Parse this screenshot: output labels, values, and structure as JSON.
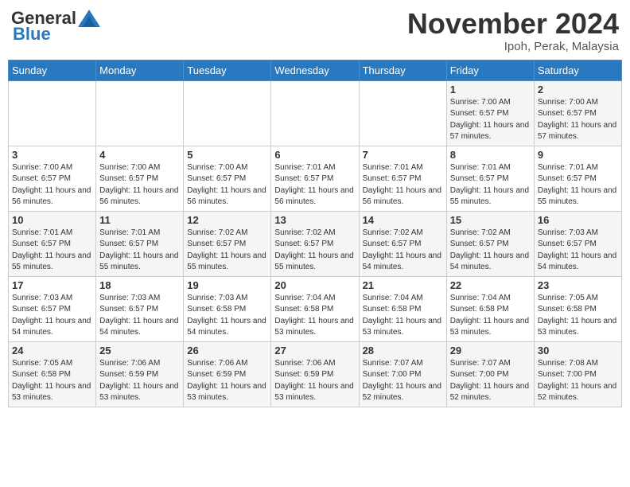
{
  "header": {
    "logo_general": "General",
    "logo_blue": "Blue",
    "month_title": "November 2024",
    "location": "Ipoh, Perak, Malaysia"
  },
  "days_of_week": [
    "Sunday",
    "Monday",
    "Tuesday",
    "Wednesday",
    "Thursday",
    "Friday",
    "Saturday"
  ],
  "weeks": [
    [
      {
        "day": "",
        "info": ""
      },
      {
        "day": "",
        "info": ""
      },
      {
        "day": "",
        "info": ""
      },
      {
        "day": "",
        "info": ""
      },
      {
        "day": "",
        "info": ""
      },
      {
        "day": "1",
        "info": "Sunrise: 7:00 AM\nSunset: 6:57 PM\nDaylight: 11 hours and 57 minutes."
      },
      {
        "day": "2",
        "info": "Sunrise: 7:00 AM\nSunset: 6:57 PM\nDaylight: 11 hours and 57 minutes."
      }
    ],
    [
      {
        "day": "3",
        "info": "Sunrise: 7:00 AM\nSunset: 6:57 PM\nDaylight: 11 hours and 56 minutes."
      },
      {
        "day": "4",
        "info": "Sunrise: 7:00 AM\nSunset: 6:57 PM\nDaylight: 11 hours and 56 minutes."
      },
      {
        "day": "5",
        "info": "Sunrise: 7:00 AM\nSunset: 6:57 PM\nDaylight: 11 hours and 56 minutes."
      },
      {
        "day": "6",
        "info": "Sunrise: 7:01 AM\nSunset: 6:57 PM\nDaylight: 11 hours and 56 minutes."
      },
      {
        "day": "7",
        "info": "Sunrise: 7:01 AM\nSunset: 6:57 PM\nDaylight: 11 hours and 56 minutes."
      },
      {
        "day": "8",
        "info": "Sunrise: 7:01 AM\nSunset: 6:57 PM\nDaylight: 11 hours and 55 minutes."
      },
      {
        "day": "9",
        "info": "Sunrise: 7:01 AM\nSunset: 6:57 PM\nDaylight: 11 hours and 55 minutes."
      }
    ],
    [
      {
        "day": "10",
        "info": "Sunrise: 7:01 AM\nSunset: 6:57 PM\nDaylight: 11 hours and 55 minutes."
      },
      {
        "day": "11",
        "info": "Sunrise: 7:01 AM\nSunset: 6:57 PM\nDaylight: 11 hours and 55 minutes."
      },
      {
        "day": "12",
        "info": "Sunrise: 7:02 AM\nSunset: 6:57 PM\nDaylight: 11 hours and 55 minutes."
      },
      {
        "day": "13",
        "info": "Sunrise: 7:02 AM\nSunset: 6:57 PM\nDaylight: 11 hours and 55 minutes."
      },
      {
        "day": "14",
        "info": "Sunrise: 7:02 AM\nSunset: 6:57 PM\nDaylight: 11 hours and 54 minutes."
      },
      {
        "day": "15",
        "info": "Sunrise: 7:02 AM\nSunset: 6:57 PM\nDaylight: 11 hours and 54 minutes."
      },
      {
        "day": "16",
        "info": "Sunrise: 7:03 AM\nSunset: 6:57 PM\nDaylight: 11 hours and 54 minutes."
      }
    ],
    [
      {
        "day": "17",
        "info": "Sunrise: 7:03 AM\nSunset: 6:57 PM\nDaylight: 11 hours and 54 minutes."
      },
      {
        "day": "18",
        "info": "Sunrise: 7:03 AM\nSunset: 6:57 PM\nDaylight: 11 hours and 54 minutes."
      },
      {
        "day": "19",
        "info": "Sunrise: 7:03 AM\nSunset: 6:58 PM\nDaylight: 11 hours and 54 minutes."
      },
      {
        "day": "20",
        "info": "Sunrise: 7:04 AM\nSunset: 6:58 PM\nDaylight: 11 hours and 53 minutes."
      },
      {
        "day": "21",
        "info": "Sunrise: 7:04 AM\nSunset: 6:58 PM\nDaylight: 11 hours and 53 minutes."
      },
      {
        "day": "22",
        "info": "Sunrise: 7:04 AM\nSunset: 6:58 PM\nDaylight: 11 hours and 53 minutes."
      },
      {
        "day": "23",
        "info": "Sunrise: 7:05 AM\nSunset: 6:58 PM\nDaylight: 11 hours and 53 minutes."
      }
    ],
    [
      {
        "day": "24",
        "info": "Sunrise: 7:05 AM\nSunset: 6:58 PM\nDaylight: 11 hours and 53 minutes."
      },
      {
        "day": "25",
        "info": "Sunrise: 7:06 AM\nSunset: 6:59 PM\nDaylight: 11 hours and 53 minutes."
      },
      {
        "day": "26",
        "info": "Sunrise: 7:06 AM\nSunset: 6:59 PM\nDaylight: 11 hours and 53 minutes."
      },
      {
        "day": "27",
        "info": "Sunrise: 7:06 AM\nSunset: 6:59 PM\nDaylight: 11 hours and 53 minutes."
      },
      {
        "day": "28",
        "info": "Sunrise: 7:07 AM\nSunset: 7:00 PM\nDaylight: 11 hours and 52 minutes."
      },
      {
        "day": "29",
        "info": "Sunrise: 7:07 AM\nSunset: 7:00 PM\nDaylight: 11 hours and 52 minutes."
      },
      {
        "day": "30",
        "info": "Sunrise: 7:08 AM\nSunset: 7:00 PM\nDaylight: 11 hours and 52 minutes."
      }
    ]
  ]
}
